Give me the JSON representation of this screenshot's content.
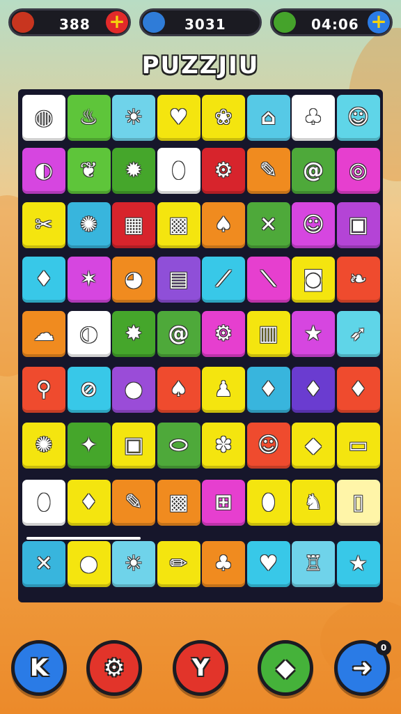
{
  "hud": {
    "lives": {
      "icon": "feather-icon",
      "value": "388",
      "color": "#c8351f"
    },
    "score": {
      "icon": "water-drop-icon",
      "value": "3031",
      "color": "#2f7cd8"
    },
    "timer": {
      "icon": "leaf-icon",
      "value": "04:06",
      "color": "#45a32b"
    }
  },
  "title": "PUZZJIU",
  "board": {
    "tiles": [
      [
        {
          "bg": "#ffffff",
          "icon": "planet-icon",
          "glyph": "◍"
        },
        {
          "bg": "#5ec53a",
          "icon": "cupcake-icon",
          "glyph": "♨"
        },
        {
          "bg": "#6fd3ea",
          "icon": "sun-icon",
          "glyph": "☀"
        },
        {
          "bg": "#f4e50f",
          "icon": "heart-icon",
          "glyph": "♥"
        },
        {
          "bg": "#f4e50f",
          "icon": "bird-icon",
          "glyph": "❀"
        },
        {
          "bg": "#56c9e6",
          "icon": "arch-icon",
          "glyph": "⌂"
        },
        {
          "bg": "#ffffff",
          "icon": "fruit-icon",
          "glyph": "♣"
        },
        {
          "bg": "#5fd5e8",
          "icon": "cherry-face-icon",
          "glyph": "☺"
        }
      ],
      [
        {
          "bg": "#d646e0",
          "icon": "saturn-icon",
          "glyph": "◐"
        },
        {
          "bg": "#5ec53a",
          "icon": "leaf-icon",
          "glyph": "❦"
        },
        {
          "bg": "#45a62b",
          "icon": "sun-flower-icon",
          "glyph": "✹"
        },
        {
          "bg": "#ffffff",
          "icon": "egg-icon",
          "glyph": "⬮"
        },
        {
          "bg": "#d7242c",
          "icon": "gear-icon",
          "glyph": "⚙"
        },
        {
          "bg": "#f08b1f",
          "icon": "feather-icon",
          "glyph": "✎"
        },
        {
          "bg": "#4ea93a",
          "icon": "spiral-icon",
          "glyph": "@"
        },
        {
          "bg": "#e63fcf",
          "icon": "ring-icon",
          "glyph": "◎"
        }
      ],
      [
        {
          "bg": "#f4e50f",
          "icon": "carrot-icon",
          "glyph": "✂"
        },
        {
          "bg": "#38b5dd",
          "icon": "splash-icon",
          "glyph": "✺"
        },
        {
          "bg": "#d7242c",
          "icon": "box-icon",
          "glyph": "▦"
        },
        {
          "bg": "#f4e50f",
          "icon": "crate-icon",
          "glyph": "▩"
        },
        {
          "bg": "#f08b1f",
          "icon": "flame-icon",
          "glyph": "♠"
        },
        {
          "bg": "#4ea93a",
          "icon": "crossed-tools-icon",
          "glyph": "✕"
        },
        {
          "bg": "#d646e0",
          "icon": "face-icon",
          "glyph": "☺"
        },
        {
          "bg": "#b444d6",
          "icon": "radio-icon",
          "glyph": "▣"
        }
      ],
      [
        {
          "bg": "#38c8e8",
          "icon": "drop-icon",
          "glyph": "♦"
        },
        {
          "bg": "#d646e0",
          "icon": "burst-icon",
          "glyph": "✶"
        },
        {
          "bg": "#f08b1f",
          "icon": "globe-icon",
          "glyph": "◕"
        },
        {
          "bg": "#8f4fd8",
          "icon": "frame-icon",
          "glyph": "▤"
        },
        {
          "bg": "#38c8e8",
          "icon": "bottle-icon",
          "glyph": "⟋"
        },
        {
          "bg": "#e63fcf",
          "icon": "brush-icon",
          "glyph": "⟍"
        },
        {
          "bg": "#f4e50f",
          "icon": "camera-icon",
          "glyph": "◙"
        },
        {
          "bg": "#ef4b2e",
          "icon": "leaf-green-icon",
          "glyph": "❧"
        }
      ],
      [
        {
          "bg": "#f08b1f",
          "icon": "blob-icon",
          "glyph": "☁"
        },
        {
          "bg": "#ffffff",
          "icon": "ball-icon",
          "glyph": "◑"
        },
        {
          "bg": "#45a62b",
          "icon": "splat-icon",
          "glyph": "✸"
        },
        {
          "bg": "#4ea93a",
          "icon": "snail-icon",
          "glyph": "@"
        },
        {
          "bg": "#e63fcf",
          "icon": "cog-icon",
          "glyph": "⚙"
        },
        {
          "bg": "#f4e50f",
          "icon": "lantern-icon",
          "glyph": "▥"
        },
        {
          "bg": "#d646e0",
          "icon": "star-face-icon",
          "glyph": "★"
        },
        {
          "bg": "#5fd5e8",
          "icon": "shuttle-icon",
          "glyph": "➶"
        }
      ],
      [
        {
          "bg": "#ef4b2e",
          "icon": "balloon-icon",
          "glyph": "⚲"
        },
        {
          "bg": "#38c8e8",
          "icon": "no-icon",
          "glyph": "⊘"
        },
        {
          "bg": "#9a4cd8",
          "icon": "orb-icon",
          "glyph": "●"
        },
        {
          "bg": "#ef4b2e",
          "icon": "lollipop-icon",
          "glyph": "♠"
        },
        {
          "bg": "#f4e50f",
          "icon": "bell-icon",
          "glyph": "♟"
        },
        {
          "bg": "#38b5dd",
          "icon": "fish-icon",
          "glyph": "♦"
        },
        {
          "bg": "#6a3cd0",
          "icon": "gem-icon",
          "glyph": "♦"
        },
        {
          "bg": "#ef4b2e",
          "icon": "lemon-icon",
          "glyph": "♦"
        }
      ],
      [
        {
          "bg": "#f4e50f",
          "icon": "virus-icon",
          "glyph": "✺"
        },
        {
          "bg": "#45a62b",
          "icon": "starfish-icon",
          "glyph": "✦"
        },
        {
          "bg": "#f4e50f",
          "icon": "picture-icon",
          "glyph": "▣"
        },
        {
          "bg": "#4ea93a",
          "icon": "bean-icon",
          "glyph": "⬭"
        },
        {
          "bg": "#f4e50f",
          "icon": "palm-leaf-icon",
          "glyph": "✽"
        },
        {
          "bg": "#ef4b2e",
          "icon": "monkey-icon",
          "glyph": "☺"
        },
        {
          "bg": "#f4e50f",
          "icon": "block-icon",
          "glyph": "◆"
        },
        {
          "bg": "#f4e50f",
          "icon": "pot-icon",
          "glyph": "▭"
        }
      ],
      [
        {
          "bg": "#ffffff",
          "icon": "seed-icon",
          "glyph": "⬮"
        },
        {
          "bg": "#f4e50f",
          "icon": "drop-blue-icon",
          "glyph": "♦"
        },
        {
          "bg": "#f08b1f",
          "icon": "torch-icon",
          "glyph": "✎"
        },
        {
          "bg": "#f08b1f",
          "icon": "crate-face-icon",
          "glyph": "▩"
        },
        {
          "bg": "#e63fcf",
          "icon": "basket-icon",
          "glyph": "⊞"
        },
        {
          "bg": "#f4e50f",
          "icon": "egg-blue-icon",
          "glyph": "⬮"
        },
        {
          "bg": "#f4e50f",
          "icon": "bird-red-icon",
          "glyph": "♞"
        },
        {
          "bg": "#fff5a8",
          "icon": "jar-icon",
          "glyph": "▯"
        }
      ],
      [
        {
          "bg": "#38b5dd",
          "icon": "crossed-swords-icon",
          "glyph": "✕"
        },
        {
          "bg": "#f4e50f",
          "icon": "berry-icon",
          "glyph": "●"
        },
        {
          "bg": "#6fd3ea",
          "icon": "smiling-sun-icon",
          "glyph": "☀"
        },
        {
          "bg": "#f4e50f",
          "icon": "pencil-icon",
          "glyph": "✏"
        },
        {
          "bg": "#f08b1f",
          "icon": "palm-tree-icon",
          "glyph": "♣"
        },
        {
          "bg": "#38c8e8",
          "icon": "apple-icon",
          "glyph": "♥"
        },
        {
          "bg": "#6fd3ea",
          "icon": "trophy-icon",
          "glyph": "♖"
        },
        {
          "bg": "#38c8e8",
          "icon": "star-icon",
          "glyph": "★"
        }
      ]
    ]
  },
  "progress": {
    "fraction": 0.3
  },
  "controls": [
    {
      "name": "back-button",
      "icon": "k-icon",
      "glyph": "K",
      "color": "#2a7be6"
    },
    {
      "name": "settings-button",
      "icon": "gear-icon",
      "glyph": "⚙",
      "color": "#e2342a"
    },
    {
      "name": "hint-button",
      "icon": "y-icon",
      "glyph": "Y",
      "color": "#e2342a"
    },
    {
      "name": "power-up-button",
      "icon": "shield-icon",
      "glyph": "◆",
      "color": "#45b23a"
    },
    {
      "name": "next-button",
      "icon": "arrow-right-icon",
      "glyph": "➜",
      "color": "#2a7be6"
    }
  ],
  "badge": "0"
}
